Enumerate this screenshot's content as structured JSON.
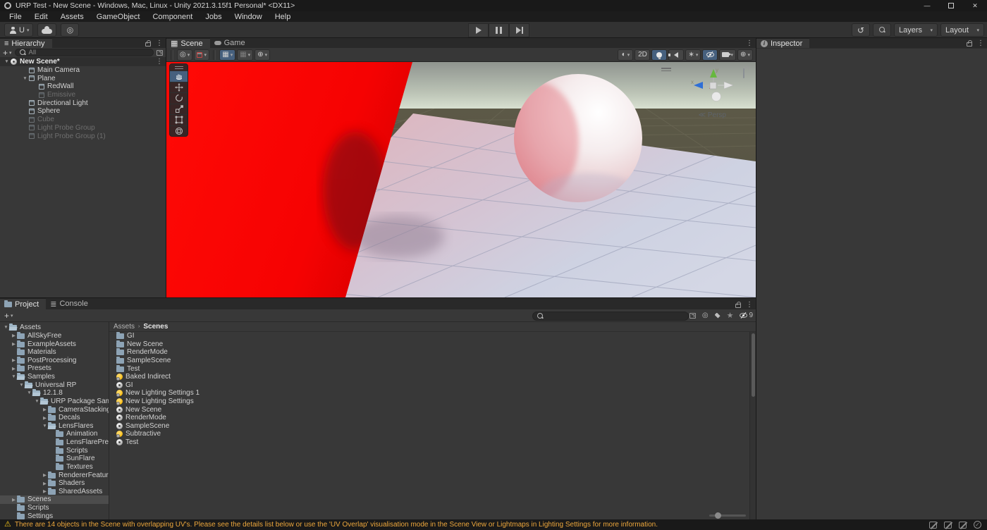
{
  "window": {
    "title": "URP Test - New Scene - Windows, Mac, Linux - Unity 2021.3.15f1 Personal* <DX11>"
  },
  "menu": {
    "items": [
      "File",
      "Edit",
      "Assets",
      "GameObject",
      "Component",
      "Jobs",
      "Window",
      "Help"
    ]
  },
  "toolbar": {
    "account_label": "U",
    "layers_label": "Layers",
    "layout_label": "Layout"
  },
  "tabs": {
    "hierarchy": "Hierarchy",
    "scene": "Scene",
    "game": "Game",
    "inspector": "Inspector",
    "project": "Project",
    "console": "Console"
  },
  "hierarchy": {
    "search_value": "All",
    "rows": [
      {
        "label": "New Scene*",
        "icon": "scene",
        "indent": 0,
        "arrow": "down",
        "header": true
      },
      {
        "label": "Main Camera",
        "icon": "cube",
        "indent": 1
      },
      {
        "label": "Plane",
        "icon": "cube",
        "indent": 1,
        "arrow": "down"
      },
      {
        "label": "RedWall",
        "icon": "cube",
        "indent": 2
      },
      {
        "label": "Emissive",
        "icon": "cube",
        "indent": 2,
        "dim": true
      },
      {
        "label": "Directional Light",
        "icon": "cube",
        "indent": 1
      },
      {
        "label": "Sphere",
        "icon": "cube",
        "indent": 1
      },
      {
        "label": "Cube",
        "icon": "cube",
        "indent": 1,
        "dim": true
      },
      {
        "label": "Light Probe Group",
        "icon": "cube",
        "indent": 1,
        "dim": true
      },
      {
        "label": "Light Probe Group (1)",
        "icon": "cube",
        "indent": 1,
        "dim": true
      }
    ]
  },
  "scene": {
    "mode_2d": "2D",
    "persp_label": "Persp",
    "persp_arrow": "≪",
    "axis_x": "x",
    "axis_y": "y"
  },
  "project": {
    "breadcrumb_root": "Assets",
    "breadcrumb_sep": "›",
    "breadcrumb_current": "Scenes",
    "hidden_count": "9",
    "tree": [
      {
        "label": "Assets",
        "indent": 0,
        "arrow": "down",
        "icon": "folder-open"
      },
      {
        "label": "AllSkyFree",
        "indent": 1,
        "arrow": "right",
        "icon": "folder"
      },
      {
        "label": "ExampleAssets",
        "indent": 1,
        "arrow": "right",
        "icon": "folder"
      },
      {
        "label": "Materials",
        "indent": 1,
        "icon": "folder"
      },
      {
        "label": "PostProcessing",
        "indent": 1,
        "arrow": "right",
        "icon": "folder"
      },
      {
        "label": "Presets",
        "indent": 1,
        "arrow": "right",
        "icon": "folder"
      },
      {
        "label": "Samples",
        "indent": 1,
        "arrow": "down",
        "icon": "folder-open"
      },
      {
        "label": "Universal RP",
        "indent": 2,
        "arrow": "down",
        "icon": "folder-open"
      },
      {
        "label": "12.1.8",
        "indent": 3,
        "arrow": "down",
        "icon": "folder-open"
      },
      {
        "label": "URP Package Sam",
        "indent": 4,
        "arrow": "down",
        "icon": "folder-open"
      },
      {
        "label": "CameraStacking",
        "indent": 5,
        "arrow": "right",
        "icon": "folder"
      },
      {
        "label": "Decals",
        "indent": 5,
        "arrow": "right",
        "icon": "folder"
      },
      {
        "label": "LensFlares",
        "indent": 5,
        "arrow": "down",
        "icon": "folder-open"
      },
      {
        "label": "Animation",
        "indent": 6,
        "icon": "folder"
      },
      {
        "label": "LensFlarePre",
        "indent": 6,
        "icon": "folder"
      },
      {
        "label": "Scripts",
        "indent": 6,
        "icon": "folder"
      },
      {
        "label": "SunFlare",
        "indent": 6,
        "icon": "folder"
      },
      {
        "label": "Textures",
        "indent": 6,
        "icon": "folder"
      },
      {
        "label": "RendererFeatur",
        "indent": 5,
        "arrow": "right",
        "icon": "folder"
      },
      {
        "label": "Shaders",
        "indent": 5,
        "arrow": "right",
        "icon": "folder"
      },
      {
        "label": "SharedAssets",
        "indent": 5,
        "arrow": "right",
        "icon": "folder"
      },
      {
        "label": "Scenes",
        "indent": 1,
        "arrow": "right",
        "icon": "folder",
        "selected": true
      },
      {
        "label": "Scripts",
        "indent": 1,
        "icon": "folder"
      },
      {
        "label": "Settings",
        "indent": 1,
        "icon": "folder"
      }
    ],
    "items": [
      {
        "label": "GI",
        "icon": "folder"
      },
      {
        "label": "New Scene",
        "icon": "folder"
      },
      {
        "label": "RenderMode",
        "icon": "folder"
      },
      {
        "label": "SampleScene",
        "icon": "folder"
      },
      {
        "label": "Test",
        "icon": "folder"
      },
      {
        "label": "Baked Indirect",
        "icon": "lighting"
      },
      {
        "label": "GI",
        "icon": "scene"
      },
      {
        "label": "New Lighting Settings 1",
        "icon": "lighting"
      },
      {
        "label": "New Lighting Settings",
        "icon": "lighting"
      },
      {
        "label": "New Scene",
        "icon": "scene"
      },
      {
        "label": "RenderMode",
        "icon": "scene"
      },
      {
        "label": "SampleScene",
        "icon": "scene"
      },
      {
        "label": "Subtractive",
        "icon": "lighting"
      },
      {
        "label": "Test",
        "icon": "scene"
      }
    ]
  },
  "status": {
    "message": "There are 14 objects in the Scene with overlapping UV's. Please see the details list below or use the 'UV Overlap' visualisation mode in the Scene View or Lightmaps in Lighting Settings for more information."
  },
  "icons": {
    "kebab": "⋮",
    "caret": "▾",
    "arrow_down": "▼",
    "arrow_right": "▶",
    "plus": "+",
    "warning": "⚠",
    "undo_history": "↺",
    "grid": "▦",
    "shaded": "◐",
    "gizmos": "⊕",
    "effects": "∗",
    "pivot": "◎",
    "hub": "◎",
    "console_tab": "≣",
    "hierarchy_tab": "≡",
    "inspector_info": "i",
    "scroll_up": "▲",
    "scroll_down": "▼",
    "window_min": "—",
    "window_close": "✕",
    "check": "✓"
  },
  "colors": {
    "accent": "#46607e",
    "selection": "#4c4c4c",
    "warning": "#eda73c",
    "wall-red": "#ff0404",
    "folder": "#8da3b5",
    "lighting-yellow": "#f2b200"
  }
}
